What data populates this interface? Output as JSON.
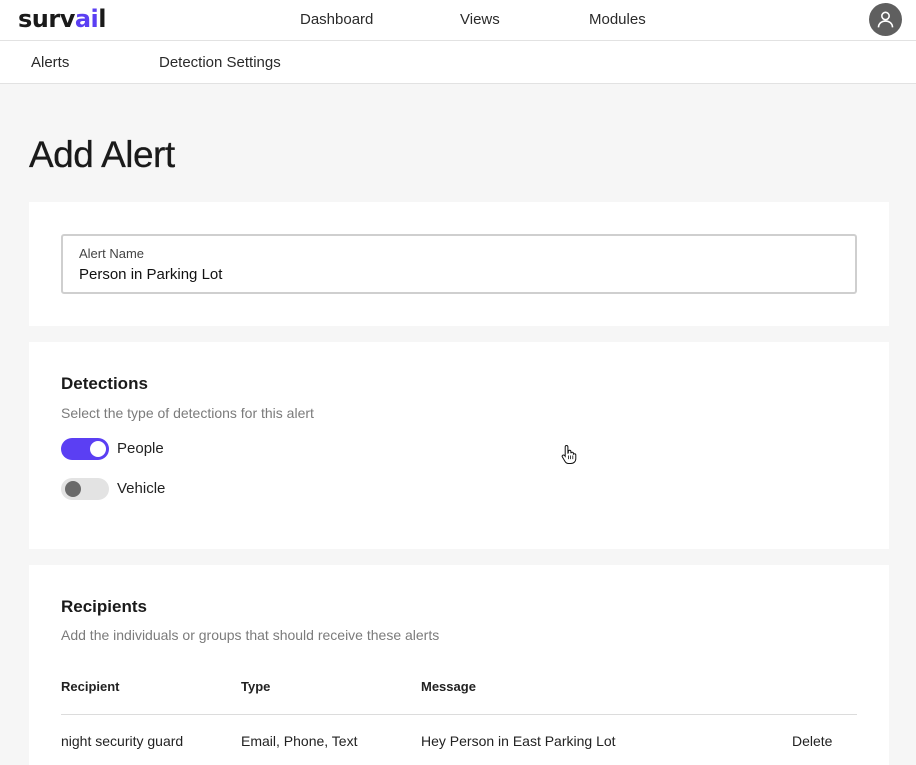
{
  "header": {
    "logo_prefix": "surv",
    "logo_accent": "ai",
    "logo_suffix": "l",
    "nav": [
      "Dashboard",
      "Views",
      "Modules"
    ],
    "avatar_icon": "user-icon"
  },
  "subnav": {
    "items": [
      "Alerts",
      "Detection Settings"
    ]
  },
  "page": {
    "title": "Add Alert"
  },
  "alert_name": {
    "label": "Alert Name",
    "value": "Person in Parking Lot"
  },
  "detections": {
    "heading": "Detections",
    "description": "Select the type of detections for this alert",
    "toggles": [
      {
        "label": "People",
        "on": true
      },
      {
        "label": "Vehicle",
        "on": false
      }
    ]
  },
  "recipients": {
    "heading": "Recipients",
    "description": "Add the individuals or groups that should receive these alerts",
    "columns": [
      "Recipient",
      "Type",
      "Message"
    ],
    "rows": [
      {
        "recipient": "night security guard",
        "type": "Email, Phone, Text",
        "message": "Hey Person in East Parking Lot",
        "action": "Delete"
      }
    ]
  },
  "colors": {
    "accent": "#5b3ff3",
    "background": "#f6f6f6",
    "card": "#ffffff"
  }
}
